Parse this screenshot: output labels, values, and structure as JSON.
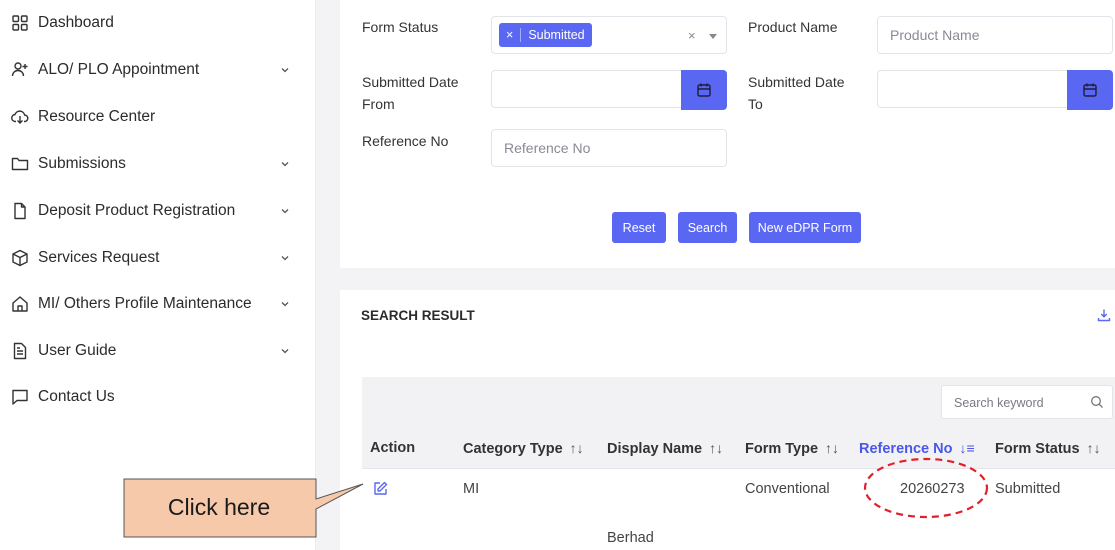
{
  "sidebar": {
    "items": [
      {
        "label": "Dashboard",
        "icon": "grid-icon",
        "has_chevron": false
      },
      {
        "label": "ALO/ PLO Appointment",
        "icon": "user-plus-icon",
        "has_chevron": true
      },
      {
        "label": "Resource Center",
        "icon": "cloud-download-icon",
        "has_chevron": false
      },
      {
        "label": "Submissions",
        "icon": "folder-icon",
        "has_chevron": true
      },
      {
        "label": "Deposit Product Registration",
        "icon": "file-icon",
        "has_chevron": true
      },
      {
        "label": "Services Request",
        "icon": "box-icon",
        "has_chevron": true
      },
      {
        "label": "MI/ Others Profile Maintenance",
        "icon": "home-icon",
        "has_chevron": true
      },
      {
        "label": "User Guide",
        "icon": "document-icon",
        "has_chevron": true
      },
      {
        "label": "Contact Us",
        "icon": "message-icon",
        "has_chevron": false
      }
    ]
  },
  "form": {
    "form_status_label": "Form Status",
    "form_status_chip_remove": "×",
    "form_status_chip": "Submitted",
    "form_status_clear": "×",
    "product_name_label": "Product Name",
    "product_name_placeholder": "Product Name",
    "submitted_from_label_1": "Submitted Date",
    "submitted_from_label_2": "From",
    "submitted_to_label_1": "Submitted Date",
    "submitted_to_label_2": "To",
    "reference_no_label": "Reference No",
    "reference_no_placeholder": "Reference No",
    "reset_label": "Reset",
    "search_label": "Search",
    "new_form_label": "New eDPR Form"
  },
  "results": {
    "title": "SEARCH RESULT",
    "search_placeholder": "Search keyword",
    "columns": [
      {
        "label": "Action",
        "sort": ""
      },
      {
        "label": "Category Type",
        "sort": "↑↓"
      },
      {
        "label": "Display Name",
        "sort": "↑↓"
      },
      {
        "label": "Form Type",
        "sort": "↑↓"
      },
      {
        "label": "Reference No",
        "sort": "↓≡"
      },
      {
        "label": "Form Status",
        "sort": "↑↓"
      }
    ],
    "row": {
      "category_type": "MI",
      "display_name_tail": "Berhad",
      "form_type": "Conventional",
      "reference_no": "20260273",
      "form_status": "Submitted"
    }
  },
  "annotation": {
    "callout_text": "Click here"
  },
  "colors": {
    "accent": "#5a67f2",
    "active_header": "#4a57e8",
    "callout_fill": "#f6c9aa",
    "oval_stroke": "#e0202a"
  }
}
